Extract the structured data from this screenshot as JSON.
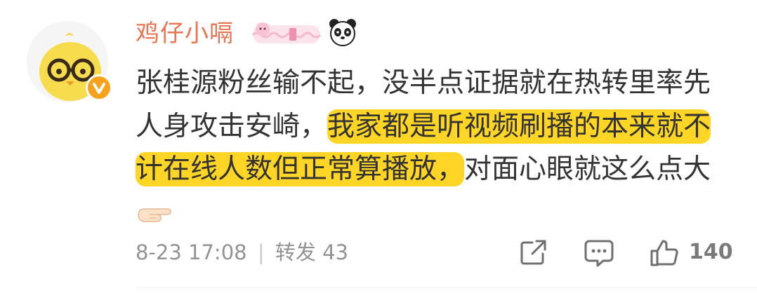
{
  "comment": {
    "username": "鸡仔小嗝",
    "content": {
      "before_highlight": "张桂源粉丝输不起，没半点证据就在热转里率先人身攻击安崎，",
      "highlight": "我家都是听视频刷播的本来就不计在线人数但正常算播放，",
      "after_highlight": "对面心眼就这么点大"
    },
    "content_emoji": "pointing-hand-icon",
    "timestamp": "8-23 17:08",
    "separator": "|",
    "repost_label": "转发",
    "repost_count": "43",
    "like_count": "140"
  },
  "colors": {
    "username": "#eb7350",
    "highlight": "#ffd526",
    "text": "#333333",
    "meta": "#939393",
    "verified_badge": "#f7a21b"
  },
  "icons": [
    "avatar-chick",
    "verified-icon",
    "fan-cake-badge-icon",
    "panda-icon",
    "share-icon",
    "comment-icon",
    "thumbs-up-icon",
    "pointing-hand-icon"
  ]
}
